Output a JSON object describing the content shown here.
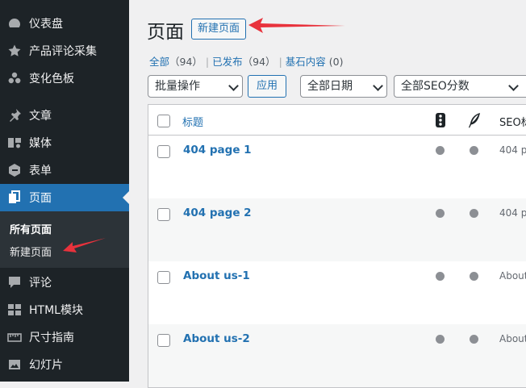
{
  "sidebar": {
    "items": [
      {
        "label": "仪表盘",
        "icon": "dashboard-icon"
      },
      {
        "label": "产品评论采集",
        "icon": "star-icon"
      },
      {
        "label": "变化色板",
        "icon": "swatches-icon"
      },
      {
        "label": "文章",
        "icon": "pin-icon"
      },
      {
        "label": "媒体",
        "icon": "media-icon"
      },
      {
        "label": "表单",
        "icon": "forms-icon"
      },
      {
        "label": "页面",
        "icon": "pages-icon"
      },
      {
        "label": "评论",
        "icon": "comment-icon"
      },
      {
        "label": "HTML模块",
        "icon": "grid-icon"
      },
      {
        "label": "尺寸指南",
        "icon": "ruler-icon"
      },
      {
        "label": "幻灯片",
        "icon": "slides-icon"
      }
    ],
    "submenu": {
      "all_pages": "所有页面",
      "add_new": "新建页面"
    }
  },
  "header": {
    "title": "页面",
    "add_new": "新建页面"
  },
  "filters": {
    "all": "全部",
    "all_count": "（94）",
    "published": "已发布",
    "published_count": "（94）",
    "elementor": "基石内容",
    "elementor_count": "(0)",
    "sep": "|"
  },
  "toolbar": {
    "bulk_actions": "批量操作",
    "apply": "应用",
    "all_dates": "全部日期",
    "all_seo": "全部SEO分数"
  },
  "table": {
    "col_title": "标题",
    "col_seo": "SEO标",
    "rows": [
      {
        "title": "404 page 1",
        "seo": "404 p"
      },
      {
        "title": "404 page 2",
        "seo": "404 p"
      },
      {
        "title": "About us-1",
        "seo": "About"
      },
      {
        "title": "About us-2",
        "seo": "About"
      }
    ]
  },
  "colors": {
    "sidebar_bg": "#1d2327",
    "active_bg": "#2271b1",
    "link": "#2271b1",
    "arrow": "#e8323c"
  }
}
